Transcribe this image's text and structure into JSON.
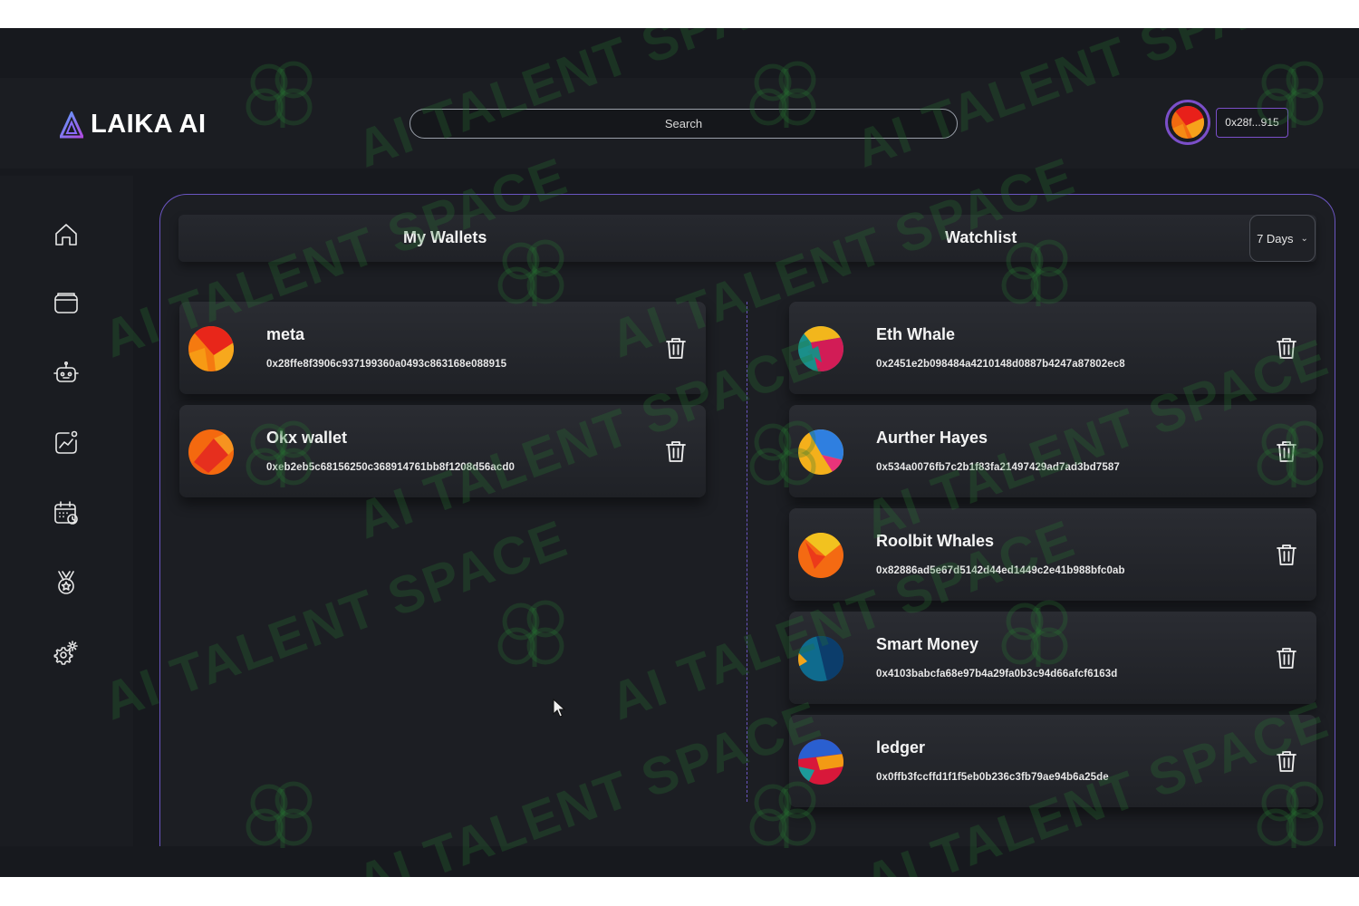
{
  "header": {
    "brand": "LAIKA AI",
    "search_placeholder": "Search",
    "wallet_address_short": "0x28f...915"
  },
  "sidebar": {
    "items": [
      {
        "name": "home-icon"
      },
      {
        "name": "wallet-icon"
      },
      {
        "name": "robot-icon"
      },
      {
        "name": "analytics-icon"
      },
      {
        "name": "calendar-icon"
      },
      {
        "name": "medal-icon"
      },
      {
        "name": "settings-icon"
      }
    ]
  },
  "panel": {
    "wallets_title": "My Wallets",
    "watchlist_title": "Watchlist",
    "period_selected": "7 Days"
  },
  "wallets": [
    {
      "name": "meta",
      "address": "0x28ffe8f3906c937199360a0493c863168e088915"
    },
    {
      "name": "Okx wallet",
      "address": "0xeb2eb5c68156250c368914761bb8f1208d56acd0"
    }
  ],
  "watchlist": [
    {
      "name": "Eth Whale",
      "address": "0x2451e2b098484a4210148d0887b4247a87802ec8"
    },
    {
      "name": "Aurther Hayes",
      "address": "0x534a0076fb7c2b1f83fa21497429ad7ad3bd7587"
    },
    {
      "name": "Roolbit Whales",
      "address": "0x82886ad5e67d5142d44ed1449c2e41b988bfc0ab"
    },
    {
      "name": "Smart Money",
      "address": "0x4103babcfa68e97b4a29fa0b3c94d66afcf6163d"
    },
    {
      "name": "ledger",
      "address": "0x0ffb3fccffd1f1f5eb0b236c3fb79ae94b6a25de"
    }
  ],
  "watermark": "AI TALENT SPACE",
  "colors": {
    "accent": "#7b4fc9",
    "background": "#17191e"
  }
}
